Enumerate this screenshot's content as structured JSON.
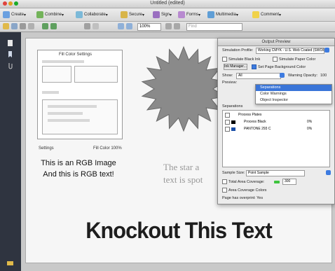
{
  "window": {
    "title": "Untitled (edited)"
  },
  "toolbar": {
    "items": [
      "Create",
      "Combine",
      "Collaborate",
      "Secure",
      "Sign",
      "Forms",
      "Multimedia",
      "Comment"
    ]
  },
  "toolbar2": {
    "zoom": "100%",
    "find_placeholder": "Find"
  },
  "document": {
    "thumb_title": "Fill Color Settings",
    "thumb_caption_left": "Settings",
    "thumb_caption_right": "Fill Color   100%",
    "rgb_line1": "This is an RGB Image",
    "rgb_line2": "And this is RGB text!",
    "star_line1": "The star a",
    "star_line2": "text is spot",
    "knockout": "Knockout This Text",
    "star_color": "#8a8a8a"
  },
  "panel": {
    "title": "Output Preview",
    "simulation_profile_label": "Simulation Profile:",
    "simulation_profile_value": "Working CMYK - U.S. Web Coated (SWOP) v2",
    "simulate_black_ink": "Simulate Black Ink",
    "simulate_paper_color": "Simulate Paper Color",
    "ink_manager": "Ink Manager...",
    "set_page_bg": "Set Page Background Color",
    "show_label": "Show:",
    "show_value": "All",
    "warning_opacity_label": "Warning Opacity:",
    "warning_opacity_value": "100",
    "preview_label": "Preview:",
    "menu": [
      "Separations",
      "Color Warnings",
      "Object Inspector"
    ],
    "separations_header": "Separations",
    "separations": [
      {
        "name": "Process Plates",
        "pct": ""
      },
      {
        "name": "Process Black",
        "pct": "0%"
      },
      {
        "name": "PANTONE 293 C",
        "pct": "0%"
      }
    ],
    "sample_size_label": "Sample Size:",
    "sample_size_value": "Point Sample",
    "total_area_label": "Total Area Coverage:",
    "total_area_value": "300",
    "area_coverage_label": "Area Coverage Colors",
    "page_has_overprint": "Page has overprint:  Yes",
    "accent": "#3a75d8"
  }
}
